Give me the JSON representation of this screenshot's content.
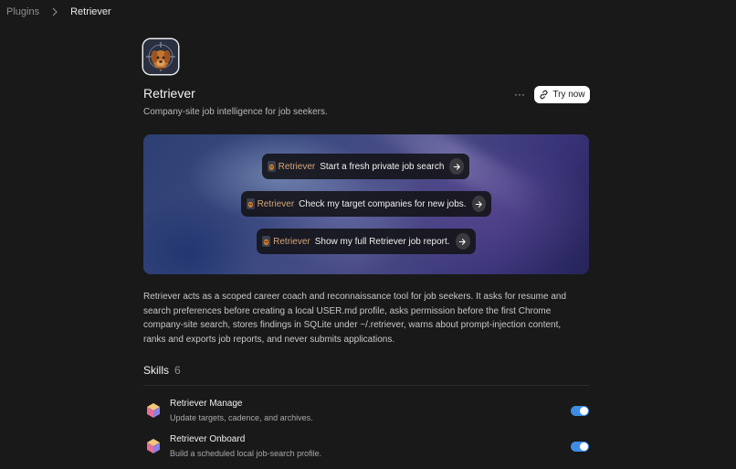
{
  "breadcrumb": {
    "parent": "Plugins",
    "current": "Retriever"
  },
  "plugin": {
    "icon": "retriever-dog-logo",
    "name": "Retriever",
    "tagline": "Company-site job intelligence for job seekers.",
    "more_label": "···",
    "try_label": "Try now"
  },
  "hero": {
    "prompts": [
      {
        "tag": "Retriever",
        "text": "Start a fresh private job search"
      },
      {
        "tag": "Retriever",
        "text": "Check my target companies for new jobs."
      },
      {
        "tag": "Retriever",
        "text": "Show my full Retriever job report."
      }
    ]
  },
  "description": "Retriever acts as a scoped career coach and reconnaissance tool for job seekers. It asks for resume and search preferences before creating a local USER.md profile, asks permission before the first Chrome company-site search, stores findings in SQLite under ~/.retriever, warns about prompt-injection content, ranks and exports job reports, and never submits applications.",
  "skills": {
    "label": "Skills",
    "count": "6",
    "items": [
      {
        "name": "Retriever Manage",
        "description": "Update targets, cadence, and archives.",
        "enabled": true
      },
      {
        "name": "Retriever Onboard",
        "description": "Build a scheduled local job-search profile.",
        "enabled": true
      }
    ]
  },
  "colors": {
    "accent": "#3f8ce6",
    "tag": "#d6a57a"
  }
}
